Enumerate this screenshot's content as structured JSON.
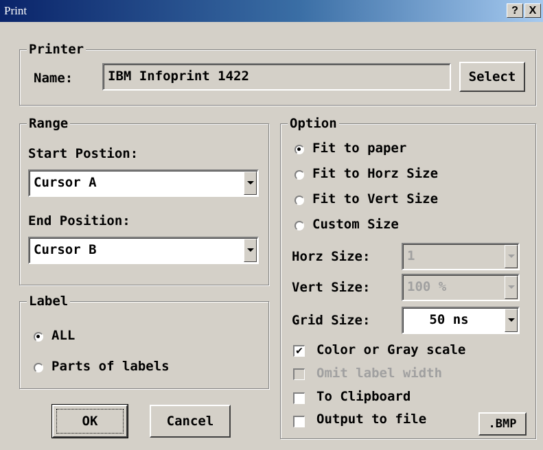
{
  "window": {
    "title": "Print",
    "help_button": "?",
    "close_button": "X"
  },
  "printer": {
    "legend": "Printer",
    "name_label": "Name:",
    "name_value": "IBM Infoprint 1422",
    "select_button": "Select"
  },
  "range": {
    "legend": "Range",
    "start_label": "Start Postion:",
    "start_value": "Cursor A",
    "end_label": "End Position:",
    "end_value": "Cursor B"
  },
  "label": {
    "legend": "Label",
    "options": [
      {
        "text": "ALL",
        "selected": true
      },
      {
        "text": "Parts of labels",
        "selected": false
      }
    ]
  },
  "option": {
    "legend": "Option",
    "fit_options": [
      {
        "text": "Fit to paper",
        "selected": true
      },
      {
        "text": "Fit to Horz Size",
        "selected": false
      },
      {
        "text": "Fit to Vert Size",
        "selected": false
      },
      {
        "text": "Custom Size",
        "selected": false
      }
    ],
    "horz_size_label": "Horz Size:",
    "horz_size_value": "1",
    "vert_size_label": "Vert Size:",
    "vert_size_value": "100 %",
    "grid_size_label": "Grid Size:",
    "grid_size_value": "50 ns",
    "checkboxes": [
      {
        "text": "Color or Gray scale",
        "checked": true,
        "enabled": true
      },
      {
        "text": "Omit label width",
        "checked": false,
        "enabled": false
      },
      {
        "text": "To Clipboard",
        "checked": false,
        "enabled": true
      },
      {
        "text": "Output to file",
        "checked": false,
        "enabled": true
      }
    ],
    "bmp_button": ".BMP"
  },
  "buttons": {
    "ok": "OK",
    "cancel": "Cancel"
  },
  "icons": {
    "dropdown": "chevron-down-icon",
    "check": "checkmark-icon"
  },
  "colors": {
    "face": "#d4d0c8",
    "title_start": "#0a246a",
    "title_end": "#a6caf0",
    "disabled_text": "#a0a0a0"
  }
}
